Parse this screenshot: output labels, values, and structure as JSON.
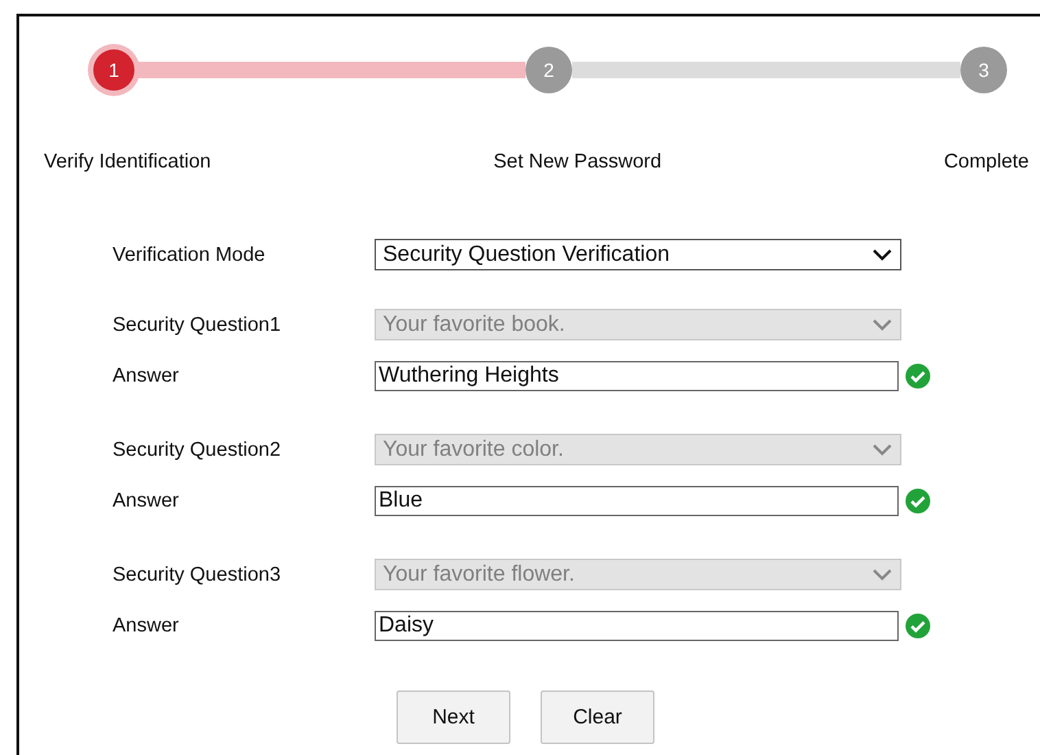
{
  "steps": [
    {
      "number": "1",
      "label": "Verify Identification",
      "selected": true
    },
    {
      "number": "2",
      "label": "Set New Password",
      "selected": false
    },
    {
      "number": "3",
      "label": "Complete",
      "selected": false
    }
  ],
  "verification_mode": {
    "label": "Verification Mode",
    "value": "Security Question Verification"
  },
  "questions": [
    {
      "label": "Security Question1",
      "question": "Your favorite book.",
      "disabled": true,
      "answer_label": "Answer",
      "answer": "Wuthering Heights",
      "valid": true
    },
    {
      "label": "Security Question2",
      "question": "Your favorite color.",
      "disabled": true,
      "answer_label": "Answer",
      "answer": "Blue",
      "valid": true
    },
    {
      "label": "Security Question3",
      "question": "Your favorite flower.",
      "disabled": true,
      "answer_label": "Answer",
      "answer": "Daisy",
      "valid": true
    }
  ],
  "buttons": [
    "Next",
    "Clear"
  ]
}
